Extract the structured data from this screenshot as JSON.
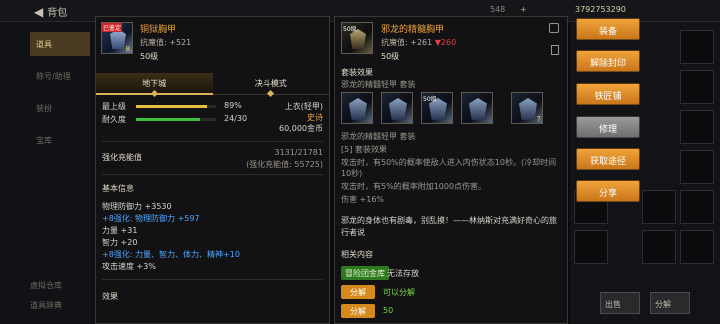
{
  "top": {
    "back_label": "背包",
    "res": "548",
    "gold": "+",
    "money": "3792753290"
  },
  "left_tabs": [
    {
      "label": "道具"
    },
    {
      "label": "称号/助理"
    },
    {
      "label": "装扮"
    },
    {
      "label": "宝库"
    }
  ],
  "left_bottom": [
    {
      "label": "虚拟仓库"
    },
    {
      "label": "道具辞典"
    }
  ],
  "right_bottom": [
    {
      "label": "出售"
    },
    {
      "label": "分解"
    }
  ],
  "left_item": {
    "name": "铜狱胸甲",
    "badge": "已鉴定",
    "level_num": "8",
    "resist_label": "抗魔值",
    "resist_value": "+521",
    "level": "50级",
    "modes": [
      "地下城",
      "决斗模式"
    ],
    "max_level_label": "最上级",
    "max_level_pct": "89%",
    "max_level_fill": 0.89,
    "durability_label": "耐久度",
    "durability_value": "24/30",
    "durability_fill": 0.8,
    "slot_type": "上衣(轻甲)",
    "rarity": "史诗",
    "price": "60,000金币",
    "enhance_label": "强化充能值",
    "enhance_value": "3131/21781",
    "enhance_sub": "(强化充能值: 55725)",
    "basic_title": "基本信息",
    "stats": [
      {
        "text": "物理防御力 +3530",
        "color": "normal"
      },
      {
        "text": "+8强化: 物理防御力 +597",
        "color": "blue"
      },
      {
        "text": "力量 +31",
        "color": "normal"
      },
      {
        "text": "智力 +20",
        "color": "normal"
      },
      {
        "text": "+8强化: 力量、智力、体力、精神+10",
        "color": "blue"
      },
      {
        "text": "攻击速度 +3%",
        "color": "normal"
      }
    ],
    "effect_title": "效果"
  },
  "right_item": {
    "name": "邪龙的精髓胸甲",
    "level_tag": "50级",
    "resist_label": "抗魔值",
    "resist_value": "+261",
    "resist_diff": "▼260",
    "level": "50级",
    "set_title": "套装效果",
    "set_name": "邪龙的精髓轻甲  套装",
    "slots": [
      {
        "lbl": "",
        "num": ""
      },
      {
        "lbl": "",
        "num": ""
      },
      {
        "lbl": "50级",
        "num": ""
      },
      {
        "lbl": "",
        "num": ""
      },
      {
        "lbl": "",
        "num": "7"
      }
    ],
    "set_name2": "邪龙的精髓轻甲  套装",
    "set_count": "[5] 套装效果",
    "effects": [
      "攻击时，有50%的概率使敌人进入内伤状态10秒。(冷却时间10秒)",
      "攻击时，有5%的概率附加1000点伤害。",
      "伤害 +16%"
    ],
    "flavor": "邪龙的身体也有剧毒，别乱摸！——林纳斯对充满好奇心的旅行者说",
    "related_title": "相关内容",
    "tags": [
      {
        "tag": "冒险团金库",
        "text": "无法存放"
      },
      {
        "tag": "分解",
        "text": "可以分解"
      },
      {
        "tag": "分解",
        "text": "50"
      }
    ]
  },
  "actions": [
    {
      "label": "装备",
      "style": "orange"
    },
    {
      "label": "解除封印",
      "style": "orange"
    },
    {
      "label": "铁匠铺",
      "style": "orange"
    },
    {
      "label": "修理",
      "style": "gray"
    },
    {
      "label": "获取途径",
      "style": "orange"
    },
    {
      "label": "分享",
      "style": "orange"
    }
  ]
}
